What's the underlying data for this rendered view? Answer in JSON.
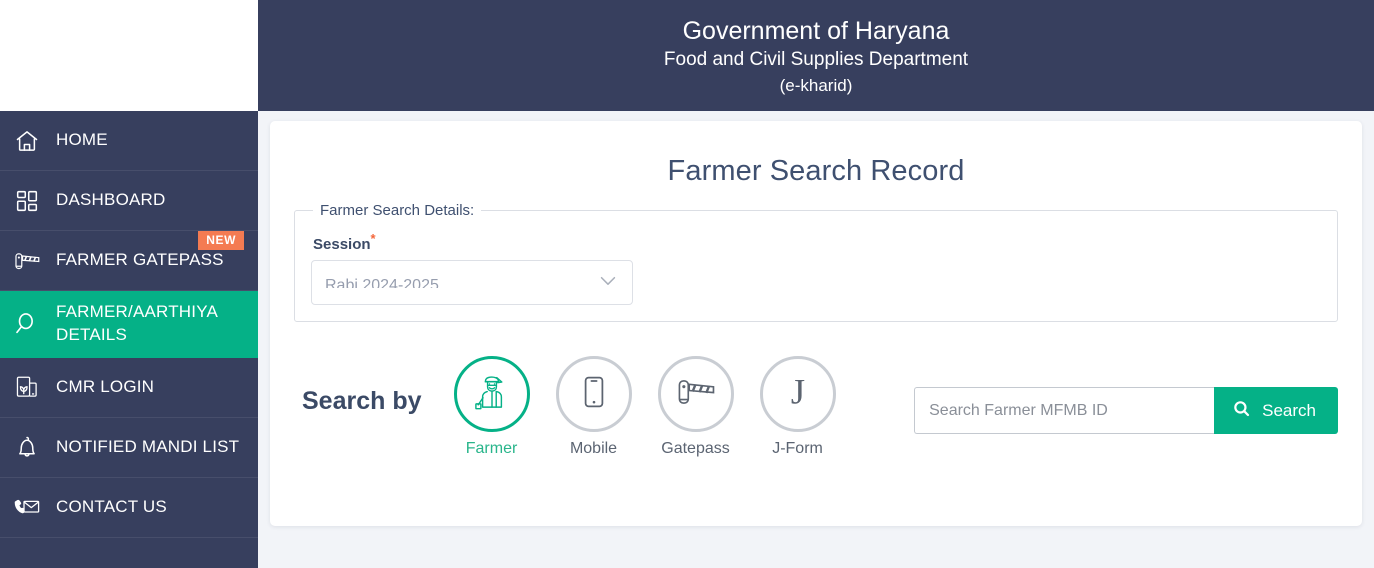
{
  "header": {
    "title": "Government of Haryana",
    "subtitle": "Food and Civil Supplies Department",
    "subtitle2": "(e-kharid)"
  },
  "sidebar": {
    "items": [
      {
        "label": "HOME",
        "icon": "home-icon",
        "active": false,
        "badge": ""
      },
      {
        "label": "DASHBOARD",
        "icon": "dashboard-icon",
        "active": false,
        "badge": ""
      },
      {
        "label": "FARMER GATEPASS",
        "icon": "barrier-gate-icon",
        "active": false,
        "badge": "NEW"
      },
      {
        "label": "FARMER/AARTHIYA DETAILS",
        "icon": "magnifier-icon",
        "active": true,
        "badge": ""
      },
      {
        "label": "CMR LOGIN",
        "icon": "grain-document-icon",
        "active": false,
        "badge": ""
      },
      {
        "label": "NOTIFIED MANDI LIST",
        "icon": "bell-icon",
        "active": false,
        "badge": ""
      },
      {
        "label": "CONTACT US",
        "icon": "phone-envelope-icon",
        "active": false,
        "badge": ""
      }
    ]
  },
  "main": {
    "page_title": "Farmer Search Record",
    "fieldset": {
      "legend": "Farmer Search Details:",
      "session": {
        "label": "Session",
        "required_mark": "*",
        "value": "Rabi 2024-2025"
      }
    },
    "search_by": {
      "label": "Search by",
      "modes": [
        {
          "name": "Farmer",
          "icon": "farmer-icon",
          "selected": true
        },
        {
          "name": "Mobile",
          "icon": "mobile-phone-icon",
          "selected": false
        },
        {
          "name": "Gatepass",
          "icon": "barrier-gate-icon",
          "selected": false
        },
        {
          "name": "J-Form",
          "icon": "j-form-icon",
          "selected": false
        }
      ]
    },
    "search": {
      "placeholder": "Search Farmer MFMB ID",
      "value": "",
      "button_label": "Search",
      "button_icon": "search-icon"
    }
  },
  "colors": {
    "navy": "#373f5e",
    "green": "#05b187",
    "badge_orange": "#f47b52",
    "page_bg": "#f2f4f8",
    "title_text": "#3f5070"
  }
}
